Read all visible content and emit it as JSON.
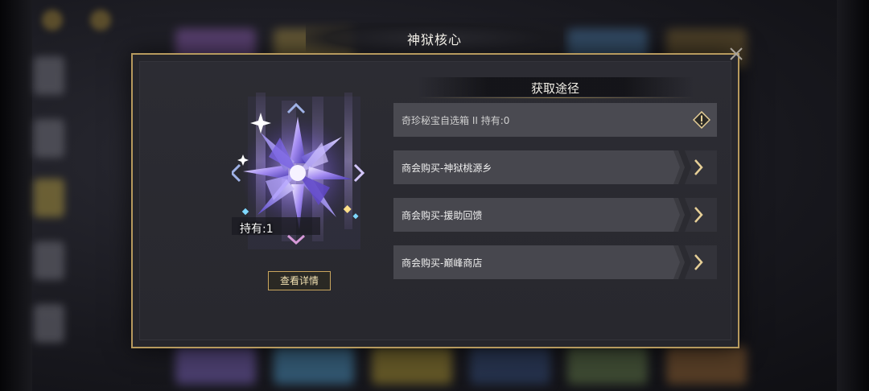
{
  "dialog": {
    "title": "神狱核心"
  },
  "item": {
    "count_label": "持有:1",
    "detail_button_label": "查看详情"
  },
  "routes": {
    "title": "获取途径",
    "items": [
      {
        "label": "奇珍秘宝自选箱 II  持有:0",
        "icon": "warning-diamond-icon"
      },
      {
        "label": "商会购买-神狱桃源乡",
        "icon": "chevron-right-icon"
      },
      {
        "label": "商会购买-援助回馈",
        "icon": "chevron-right-icon"
      },
      {
        "label": "商会购买-巅峰商店",
        "icon": "chevron-right-icon"
      }
    ]
  },
  "colors": {
    "frame_gold": "#b79a5e",
    "route_bg": "#47474e",
    "crystal": "#8a6df0"
  }
}
